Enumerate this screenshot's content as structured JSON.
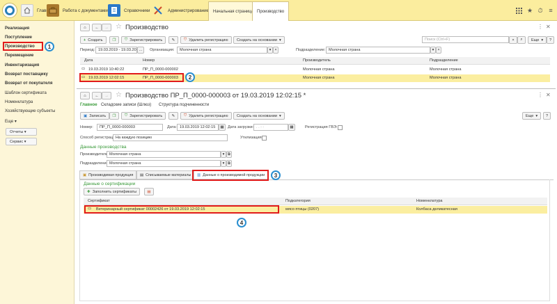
{
  "sections": [
    {
      "label": "Главное",
      "icon": "home-icon",
      "color": "#e8e8e8"
    },
    {
      "label": "Работа с документами",
      "icon": "briefcase-icon",
      "color": "#a8782c"
    },
    {
      "label": "Справочники",
      "icon": "book-icon",
      "color": "#2a78c8"
    },
    {
      "label": "Администрирование",
      "icon": "tools-icon",
      "color": "#d04a2a"
    }
  ],
  "tabs": [
    "Начальная страница",
    "Производство"
  ],
  "sidebar": {
    "items": [
      "Реализация",
      "Поступление",
      "Производство",
      "Перемещение",
      "Инвентаризация",
      "Возврат поставщику",
      "Возврат от покупателя",
      "Шаблон сертификата",
      "Номенклатура",
      "Хозяйствующие субъекты",
      "Еще"
    ],
    "buttons": [
      "Отчеты",
      "Сервис"
    ]
  },
  "list": {
    "title": "Производство",
    "create": "Создать",
    "register": "Зарегистрировать",
    "unregister": "Удалить регистрацию",
    "create_based": "Создать на основании",
    "search_placeholder": "Поиск (Ctrl+F)",
    "more": "Еще",
    "help": "?",
    "period_label": "Период:",
    "period_value": "19.03.2019 - 19.03.2019",
    "org_label": "Организация:",
    "org_value": "Молочная страна",
    "dept_label": "Подразделение:",
    "dept_value": "Молочная страна",
    "columns": [
      "Дата",
      "Номер",
      "Производитель",
      "Подразделение"
    ],
    "rows": [
      {
        "date": "19.03.2019 10:40:22",
        "number": "ПР_П_0000-000002",
        "producer": "Молочная страна",
        "dept": "Молочная страна"
      },
      {
        "date": "19.03.2019 12:02:15",
        "number": "ПР_П_0000-000003",
        "producer": "Молочная страна",
        "dept": "Молочная страна"
      }
    ]
  },
  "doc": {
    "title": "Производство ПР_П_0000-000003 от 19.03.2019 12:02:15 *",
    "nav": [
      "Главное",
      "Складские записи (Шлюз)",
      "Структура подчиненности"
    ],
    "save": "Записать",
    "register": "Зарегистрировать",
    "unregister": "Удалить регистрацию",
    "create_based": "Создать на основании",
    "more": "Еще",
    "help": "?",
    "number_label": "Номер:",
    "number_value": "ПР_П_0000-000003",
    "date_label": "Дата:",
    "date_value": "19.03.2019 12:02:15",
    "load_date_label": "Дата загрузки:",
    "load_date_value": ". .  : :",
    "gve_label": "Регистрация ГВЭ:",
    "reg_method_label": "Способ регистрации:",
    "reg_method_value": "На каждую позицию",
    "disposal_label": "Утилизация:",
    "prod_data_title": "Данные производства",
    "producer_label": "Производитель:",
    "producer_value": "Молочная страна",
    "dept_label": "Подразделение:",
    "dept_value": "Молочная страна",
    "panel_tabs": [
      "Производимая продукция",
      "Списываемые материалы",
      "Данные о производимой продукции"
    ],
    "cert_title": "Данные о сертификации",
    "fill_button": "Заполнить сертификаты",
    "cert_columns": [
      "Сертификат",
      "Подкатегория",
      "Номенклатура"
    ],
    "cert_row": {
      "cert": "Ветеринарный сертификат 00002426 от 19.03.2019 12:02:15",
      "subcat": "мясо птицы (0207)",
      "nomen": "Колбаса деликатесная"
    }
  },
  "badges": [
    "1",
    "2",
    "3",
    "4"
  ],
  "colors": {
    "accent": "#fbed9e",
    "highlight": "#e11b1b",
    "badge": "#2a8fd0",
    "selected_row": "#fbeea0"
  }
}
